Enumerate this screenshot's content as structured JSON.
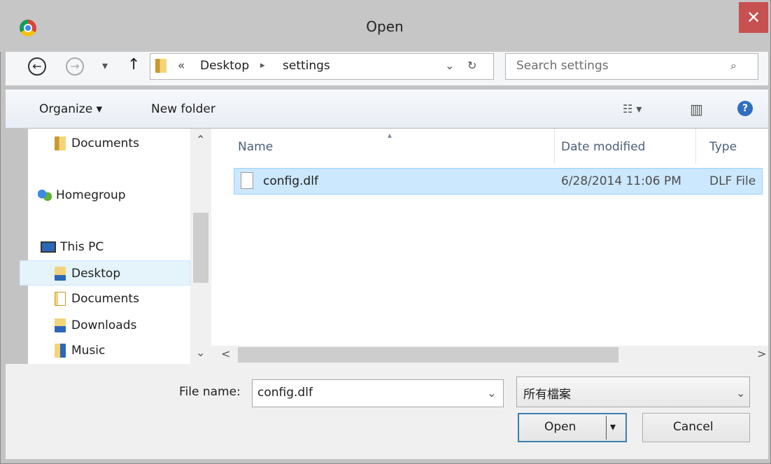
{
  "window": {
    "title": "Open",
    "close_glyph": "✕",
    "app_icon": "chrome-icon"
  },
  "nav": {
    "back_glyph": "←",
    "forward_glyph": "→",
    "recent_glyph": "▾",
    "up_glyph": "↑",
    "breadcrumb_overflow": "«",
    "breadcrumb": [
      "Desktop",
      "settings"
    ],
    "breadcrumb_sep": "▸",
    "dropdown_glyph": "⌄",
    "refresh_glyph": "↻",
    "search_placeholder": "Search settings",
    "search_glyph": "⌕"
  },
  "toolbar": {
    "organize_label": "Organize ▾",
    "new_folder_label": "New folder",
    "view_glyph": "☷ ▾",
    "preview_glyph": "▥",
    "help_glyph": "?"
  },
  "sidebar": {
    "scroll_up": "⌃",
    "scroll_down": "⌄",
    "items": [
      {
        "label": "Documents",
        "icon": "folder-icon"
      },
      {
        "label": "Homegroup",
        "icon": "homegroup-icon"
      },
      {
        "label": "This PC",
        "icon": "computer-icon"
      },
      {
        "label": "Desktop",
        "icon": "desktop-folder-icon"
      },
      {
        "label": "Documents",
        "icon": "documents-folder-icon"
      },
      {
        "label": "Downloads",
        "icon": "downloads-folder-icon"
      },
      {
        "label": "Music",
        "icon": "music-folder-icon"
      }
    ]
  },
  "filelist": {
    "columns": [
      "Name",
      "Date modified",
      "Type"
    ],
    "sort_glyph": "▴",
    "rows": [
      {
        "name": "config.dlf",
        "date": "6/28/2014 11:06 PM",
        "type": "DLF File"
      }
    ],
    "scroll_left": "<",
    "scroll_right": ">"
  },
  "footer": {
    "filename_label": "File name:",
    "filename_value": "config.dlf",
    "filetype_value": "所有檔案",
    "dropdown_glyph": "⌄",
    "open_label": "Open",
    "open_split_glyph": "▾",
    "cancel_label": "Cancel"
  },
  "colors": {
    "selection": "#cce8ff",
    "close": "#c75050",
    "header_text": "#4c607a"
  }
}
